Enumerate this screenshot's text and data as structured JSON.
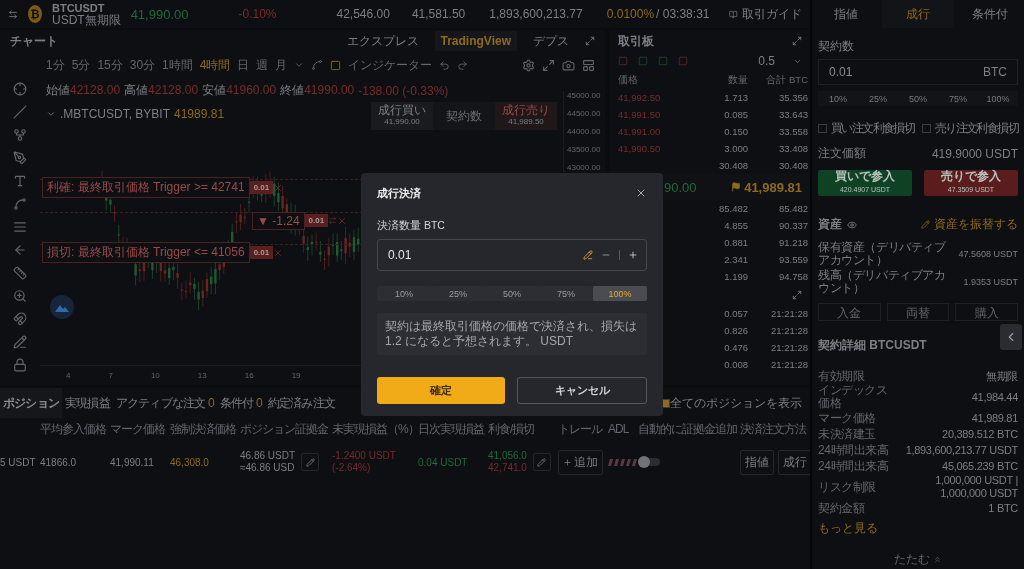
{
  "ticker": {
    "logo_glyph": "₿",
    "symbol": "BTCUSDT",
    "contract": "USDT無期限",
    "last_price": "41,990.00",
    "change": "-0.10%",
    "high": "42,546.00",
    "low": "41,581.50",
    "turnover": "1,893,600,213.77",
    "funding_rate": "0.0100%",
    "countdown": "/ 03:38:31",
    "guide": "取引ガイド"
  },
  "chart": {
    "title": "チャート",
    "views": [
      {
        "label": "エクスプレス",
        "selected": false
      },
      {
        "label": "TradingView",
        "selected": true
      },
      {
        "label": "デプス",
        "selected": false
      }
    ],
    "intervals": [
      {
        "label": "1分",
        "selected": false
      },
      {
        "label": "5分",
        "selected": false
      },
      {
        "label": "15分",
        "selected": false
      },
      {
        "label": "30分",
        "selected": false
      },
      {
        "label": "1時間",
        "selected": false
      },
      {
        "label": "4時間",
        "selected": true
      },
      {
        "label": "日",
        "selected": false
      },
      {
        "label": "週",
        "selected": false
      },
      {
        "label": "月",
        "selected": false
      }
    ],
    "indicator": "インジケーター",
    "legend": [
      {
        "label": "始値",
        "value": "42128.00"
      },
      {
        "label": "高値",
        "value": "42128.00"
      },
      {
        "label": "安値",
        "value": "41960.00"
      },
      {
        "label": "終値",
        "value": "41990.00"
      }
    ],
    "change": "-138.00 (-0.33%)",
    "symbol": ".MBTCUSDT, BYBIT",
    "mark": "41989.81",
    "quick_trade": {
      "buy_label": "成行買い",
      "buy_price": "41,990.00",
      "qty_label": "契約数",
      "sell_label": "成行売り",
      "sell_price": "41,989.50"
    },
    "order_lines": [
      {
        "kind": "trigger",
        "label": "利確: 最終取引価格 Trigger >= 42741",
        "qty": "0.01"
      },
      {
        "kind": "position",
        "label": "▼ -1.24",
        "qty": "0.01"
      },
      {
        "kind": "trigger",
        "label": "損切: 最終取引価格 Trigger <= 41056",
        "qty": "0.01"
      }
    ],
    "y_axis": [
      "45000.00",
      "44500.00",
      "44000.00",
      "43500.00",
      "43000.00"
    ],
    "x_axis": [
      "4",
      "7",
      "10",
      "13",
      "16",
      "19"
    ]
  },
  "orderbook": {
    "title": "取引板",
    "step": "0.5",
    "columns": [
      "価格",
      "数量",
      "合計 BTC"
    ],
    "asks": [
      {
        "price": "41,992.50",
        "qty": "1.713",
        "total": "35.356"
      },
      {
        "price": "41,991.50",
        "qty": "0.085",
        "total": "33.643"
      },
      {
        "price": "41,991.00",
        "qty": "0.150",
        "total": "33.558"
      },
      {
        "price": "41,990.50",
        "qty": "3.000",
        "total": "33.408"
      },
      {
        "qty": "30.408",
        "total": "30.408"
      }
    ],
    "last": "90.00",
    "mark": "41,989.81",
    "bids": [
      {
        "qty": "85.482",
        "total": "85.482"
      },
      {
        "qty": "4.855",
        "total": "90.337"
      },
      {
        "qty": "0.881",
        "total": "91.218"
      },
      {
        "qty": "2.341",
        "total": "93.559"
      },
      {
        "qty": "1.199",
        "total": "94.758"
      }
    ],
    "trades": [
      {
        "qty": "0.057",
        "time": "21:21:28"
      },
      {
        "qty": "0.826",
        "time": "21:21:28"
      },
      {
        "qty": "0.476",
        "time": "21:21:28"
      },
      {
        "qty": "0.008",
        "time": "21:21:28"
      }
    ]
  },
  "positions": {
    "tabs": [
      {
        "label": "ポジション",
        "selected": true
      },
      {
        "label": "実現損益",
        "selected": false
      },
      {
        "label": "アクティブな注文",
        "count": "0",
        "selected": false
      },
      {
        "label": "条件付",
        "count": "0",
        "selected": false
      },
      {
        "label": "約定済み注文",
        "selected": false
      }
    ],
    "show_all": {
      "label": "全てのポジションを表示",
      "checked": true
    },
    "columns": [
      "平均参入価格",
      "マーク価格",
      "強制決済価格",
      "ポジション証拠金",
      "未実現損益（%）",
      "日次実現損益",
      "利食/損切",
      "トレール",
      "ADL",
      "自動的に証拠金追加",
      "決済注文方法"
    ],
    "row": {
      "column_1": "5 USDT",
      "entry": "41866.0",
      "mark": "41,990.11",
      "liquidation": "46,308.0",
      "margin": "46.86 USDT",
      "margin_usd": "≈46.86 USD",
      "pnl": "-1.2400 USDT",
      "pnl_pct": "(-2.64%)",
      "daily_pnl": "0.04 USDT",
      "take_profit": "41,056.0",
      "stop_loss": "42,741.0",
      "trail_button": "追加",
      "auto_margin": false,
      "close_buttons": [
        "指値",
        "成行"
      ]
    }
  },
  "order_panel": {
    "tabs": [
      {
        "label": "指値",
        "selected": false
      },
      {
        "label": "成行",
        "selected": true
      },
      {
        "label": "条件付",
        "selected": false
      }
    ],
    "qty_label": "契約数",
    "qty": "0.01",
    "qty_unit": "BTC",
    "percents": [
      "10%",
      "25%",
      "50%",
      "75%",
      "100%"
    ],
    "options": [
      {
        "label": "買い注文利食損切",
        "checked": false
      },
      {
        "label": "売り注文利食損切",
        "checked": false
      }
    ],
    "order_value_label": "注文価額",
    "order_value": "419.9000 USDT",
    "buy": {
      "label": "買いで参入",
      "sub": "420.4907 USDT"
    },
    "sell": {
      "label": "売りで参入",
      "sub": "47.3509 USDT"
    },
    "assets_title": "資産",
    "transfer": "資産を振替する",
    "balances": [
      {
        "label": "保有資産（デリバティブアカウント）",
        "value": "47.5608 USDT"
      },
      {
        "label": "残高（デリバティブアカウント）",
        "value": "1.9353 USDT"
      }
    ],
    "actions": [
      "入金",
      "両替",
      "購入"
    ],
    "details_title": "契約詳細 BTCUSDT",
    "details": [
      {
        "label": "有効期限",
        "value": "無期限"
      },
      {
        "label": "インデックス価格",
        "value": "41,984.44"
      },
      {
        "label": "マーク価格",
        "value": "41,989.81"
      },
      {
        "label": "未決済建玉",
        "value": "20,389.512 BTC"
      },
      {
        "label": "24時間出来高",
        "value": "1,893,600,213.77 USDT"
      },
      {
        "label": "24時間出来高",
        "value": "45,065.239 BTC"
      },
      {
        "label": "リスク制限",
        "value": "1,000,000 USDT | 1,000,000 USDT"
      },
      {
        "label": "契約金額",
        "value": "1 BTC"
      }
    ],
    "more": "もっと見る",
    "collapse": "たたむ"
  },
  "modal": {
    "title": "成行決済",
    "qty_label": "決済数量 BTC",
    "qty": "0.01",
    "percents": [
      {
        "label": "10%",
        "selected": false
      },
      {
        "label": "25%",
        "selected": false
      },
      {
        "label": "50%",
        "selected": false
      },
      {
        "label": "75%",
        "selected": false
      },
      {
        "label": "100%",
        "selected": true
      }
    ],
    "note": "契約は最終取引価格の価格で決済され、損失は1.2 になると予想されます。 USDT",
    "confirm": "確定",
    "cancel": "キャンセル"
  }
}
